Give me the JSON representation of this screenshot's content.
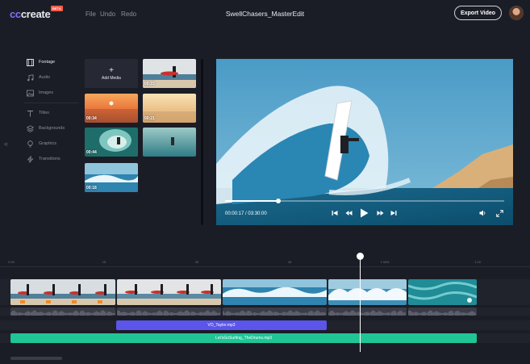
{
  "app": {
    "logo_prefix": "cc",
    "logo_rest": "create",
    "beta": "BETA"
  },
  "menu": {
    "file": "File",
    "undo": "Undo",
    "redo": "Redo"
  },
  "project_title": "SwellChasers_MasterEdit",
  "export_label": "Export Video",
  "sidebar": {
    "items": [
      {
        "label": "Footage",
        "icon": "film-icon",
        "active": true
      },
      {
        "label": "Audio",
        "icon": "music-note-icon",
        "active": false
      },
      {
        "label": "Images",
        "icon": "image-icon",
        "active": false
      },
      {
        "label": "Titles",
        "icon": "text-icon",
        "active": false
      },
      {
        "label": "Backgrounds",
        "icon": "layers-icon",
        "active": false
      },
      {
        "label": "Graphics",
        "icon": "bulb-icon",
        "active": false
      },
      {
        "label": "Transitions",
        "icon": "lightning-icon",
        "active": false
      }
    ],
    "collapse_glyph": "«"
  },
  "media": {
    "add_label": "Add Media",
    "thumbs": [
      {
        "duration": "00:15"
      },
      {
        "duration": "00:34"
      },
      {
        "duration": "00:21"
      },
      {
        "duration": "00:44"
      },
      {
        "duration": ""
      },
      {
        "duration": "00:18"
      }
    ]
  },
  "player": {
    "timecode": "00:00:17 / 03:30:00",
    "progress": 0.19
  },
  "timeline": {
    "ruler": [
      "0:00",
      "15",
      "30",
      "45",
      "1 MIN",
      "1:15"
    ],
    "voiceover": "VO_Taylor.mp3",
    "music": "Let'sGoSurfing_TheDrums.mp3"
  },
  "colors": {
    "accent": "#5b55ea",
    "music": "#1fc595",
    "background": "#1b1d26"
  }
}
